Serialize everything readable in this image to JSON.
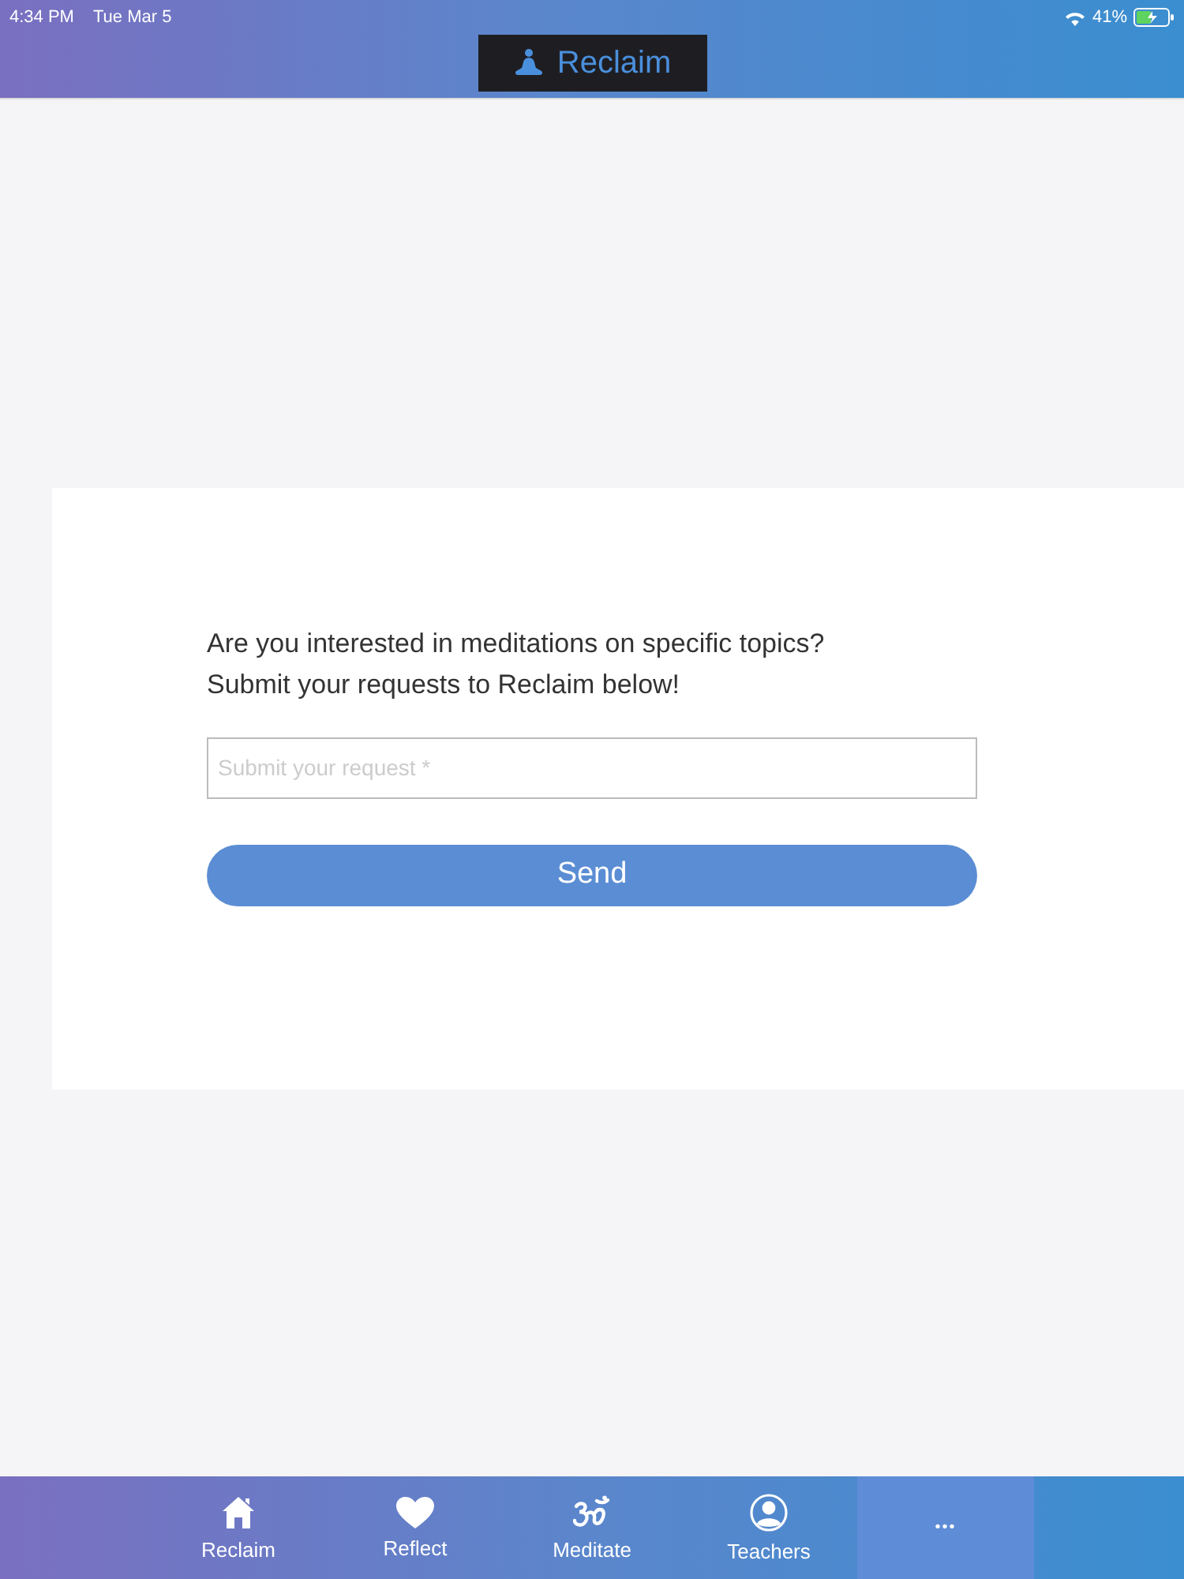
{
  "status_bar": {
    "time": "4:34 PM",
    "date": "Tue Mar 5",
    "battery": "41%"
  },
  "header": {
    "title": "Reclaim"
  },
  "form": {
    "prompt_lines": [
      "Are you interested in meditations on specific topics?",
      "Submit your requests to Reclaim below!"
    ],
    "request_field": {
      "placeholder": "Submit your request *"
    },
    "send_button": "Send"
  },
  "tab_bar": [
    {
      "label": "Reclaim",
      "kind": "house",
      "selected": false
    },
    {
      "label": "Reflect",
      "kind": "heart",
      "selected": false
    },
    {
      "label": "Meditate",
      "kind": "om",
      "selected": false
    },
    {
      "label": "Teachers",
      "kind": "person",
      "selected": false
    },
    {
      "label": "•••",
      "kind": "more",
      "selected": true
    }
  ]
}
